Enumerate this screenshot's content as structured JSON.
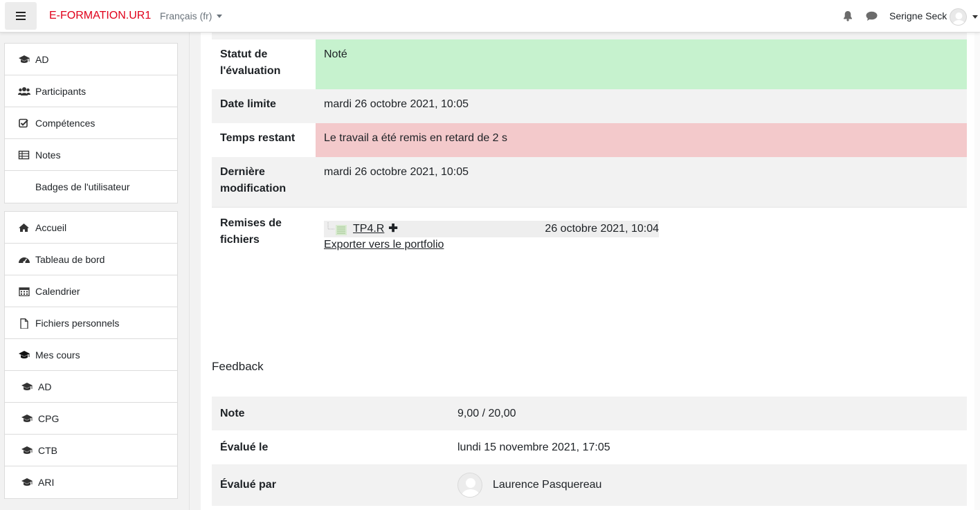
{
  "navbar": {
    "brand": "E-FORMATION.UR1",
    "language": "Français (fr)",
    "user_name": "Serigne Seck",
    "icons": [
      "menu-icon",
      "bell-icon",
      "chat-icon",
      "avatar-icon"
    ]
  },
  "sidebar": {
    "course_block": [
      {
        "label": "AD",
        "icon": "graduation-cap-icon"
      },
      {
        "label": "Participants",
        "icon": "users-icon"
      },
      {
        "label": "Compétences",
        "icon": "checkbox-icon"
      },
      {
        "label": "Notes",
        "icon": "table-icon"
      },
      {
        "label": "Badges de l'utilisateur",
        "icon": ""
      }
    ],
    "site_block": [
      {
        "label": "Accueil",
        "icon": "home-icon"
      },
      {
        "label": "Tableau de bord",
        "icon": "dashboard-icon"
      },
      {
        "label": "Calendrier",
        "icon": "calendar-icon"
      },
      {
        "label": "Fichiers personnels",
        "icon": "file-icon"
      },
      {
        "label": "Mes cours",
        "icon": "graduation-cap-icon"
      },
      {
        "label": "AD",
        "icon": "graduation-cap-icon"
      },
      {
        "label": "CPG",
        "icon": "graduation-cap-icon"
      },
      {
        "label": "CTB",
        "icon": "graduation-cap-icon"
      },
      {
        "label": "ARI",
        "icon": "graduation-cap-icon"
      }
    ]
  },
  "submission": {
    "status_label": "Statut de l'évaluation",
    "status_value": "Noté",
    "due_label": "Date limite",
    "due_value": "mardi 26 octobre 2021, 10:05",
    "remaining_label": "Temps restant",
    "remaining_value": "Le travail a été remis en retard de 2 s",
    "modified_label": "Dernière modification",
    "modified_value": "mardi 26 octobre 2021, 10:05",
    "files_label": "Remises de fichiers",
    "file_name": "TP4.R",
    "file_plus": "✚",
    "file_date": "26 octobre 2021, 10:04",
    "export_link": "Exporter vers le portfolio"
  },
  "feedback": {
    "title": "Feedback",
    "grade_label": "Note",
    "grade_value": "9,00 / 20,00",
    "graded_on_label": "Évalué le",
    "graded_on_value": "lundi 15 novembre 2021, 17:05",
    "graded_by_label": "Évalué par",
    "graded_by_value": "Laurence Pasquereau"
  },
  "colors": {
    "brand": "#e0001a",
    "status_ok": "#c6f2ce",
    "status_late": "#f3c9cb"
  }
}
